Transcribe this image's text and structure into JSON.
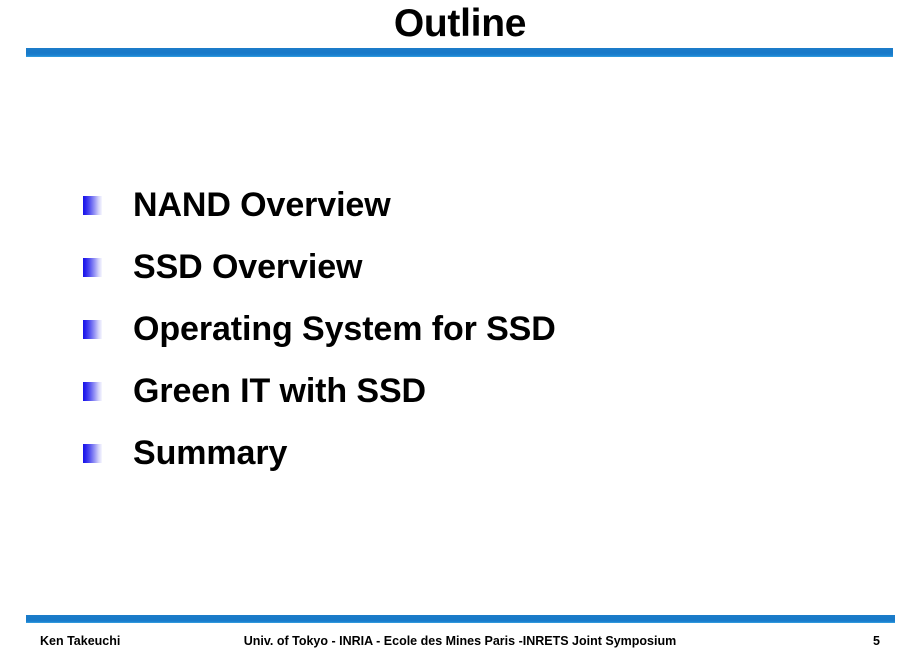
{
  "slide": {
    "title": "Outline",
    "page_number": "5",
    "accent_color": "#1879c8",
    "bullet_gradient_start": "#1712e8",
    "bullet_gradient_end": "#f7f7fe",
    "text_color": "#000000",
    "background_color": "#ffffff"
  },
  "body": {
    "bullets": [
      {
        "label": "NAND Overview"
      },
      {
        "label": "SSD Overview"
      },
      {
        "label": "Operating System for SSD"
      },
      {
        "label": "Green IT with SSD"
      },
      {
        "label": "Summary"
      }
    ]
  },
  "footer": {
    "author": "Ken Takeuchi",
    "event": "Univ. of Tokyo - INRIA - Ecole des Mines Paris -INRETS Joint Symposium",
    "page": "5"
  }
}
